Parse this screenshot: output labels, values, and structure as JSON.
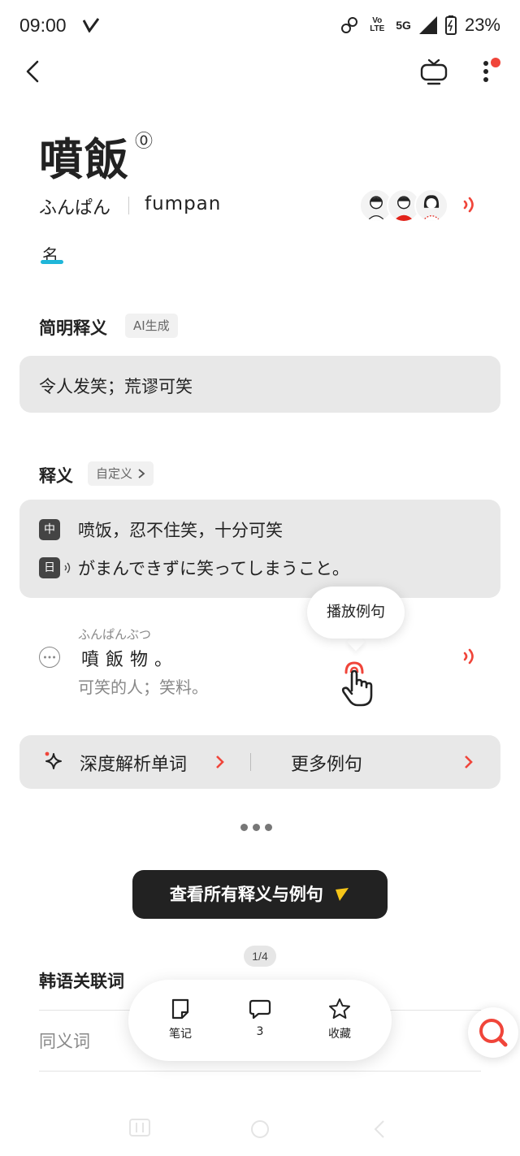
{
  "status_bar": {
    "time": "09:00",
    "network_badge": "Vo LTE",
    "signal": "5G",
    "battery": "23%"
  },
  "word": {
    "title": "噴飯",
    "sup": "⓪",
    "reading": "ふんぱん",
    "romaji": "fumpan",
    "part_of_speech": "名"
  },
  "brief": {
    "section_title": "简明释义",
    "chip": "AI生成",
    "text": "令人发笑；荒谬可笑"
  },
  "definition": {
    "section_title": "释义",
    "chip": "自定义",
    "zh_badge": "中",
    "zh_text": "喷饭，忍不住笑，十分可笑",
    "jp_badge": "日",
    "jp_text": "がまんできずに笑ってしまうこと。"
  },
  "tooltip": "播放例句",
  "example": {
    "ruby": "ふんぱんぶつ",
    "jp": "噴飯物。",
    "cn": "可笑的人；笑料。"
  },
  "actions": {
    "deep": "深度解析单词",
    "more": "更多例句"
  },
  "view_all": "查看所有释义与例句",
  "page_indicator": "1/4",
  "korean": {
    "title": "韩语关联词",
    "synonym_label": "同义词"
  },
  "float_bar": {
    "note": "笔记",
    "comments": "3",
    "favorite": "收藏"
  },
  "colors": {
    "accent_red": "#f0453a",
    "underline_blue": "#1fb6d9",
    "card_bg": "#e8e8e8",
    "dark_button": "#222222",
    "yellow": "#f5c518"
  }
}
